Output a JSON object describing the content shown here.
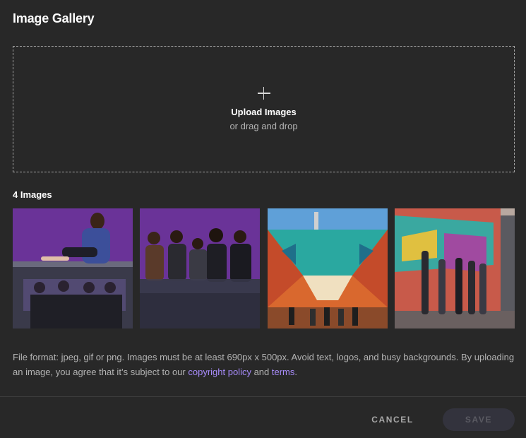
{
  "dialog": {
    "title": "Image Gallery",
    "upload": {
      "icon": "plus-icon",
      "label": "Upload Images",
      "sublabel": "or drag and drop"
    },
    "images_count": "4 Images",
    "images": [
      {
        "name": "gallery-image-1",
        "description_icon": "photo"
      },
      {
        "name": "gallery-image-2",
        "description_icon": "photo"
      },
      {
        "name": "gallery-image-3",
        "description_icon": "photo"
      },
      {
        "name": "gallery-image-4",
        "description_icon": "photo"
      }
    ],
    "footnote": {
      "text_1": "File format: jpeg, gif or png. Images must be at least 690px x 500px. Avoid text, logos, and busy backgrounds. By uploading an image, you agree that it’s subject to our ",
      "link_copyright": "copyright policy",
      "text_2": " and ",
      "link_terms": "terms",
      "text_3": "."
    },
    "buttons": {
      "cancel": "CANCEL",
      "save": "SAVE"
    },
    "colors": {
      "background": "#282828",
      "link": "#a78bfa",
      "save_disabled_bg": "#33333d"
    }
  }
}
